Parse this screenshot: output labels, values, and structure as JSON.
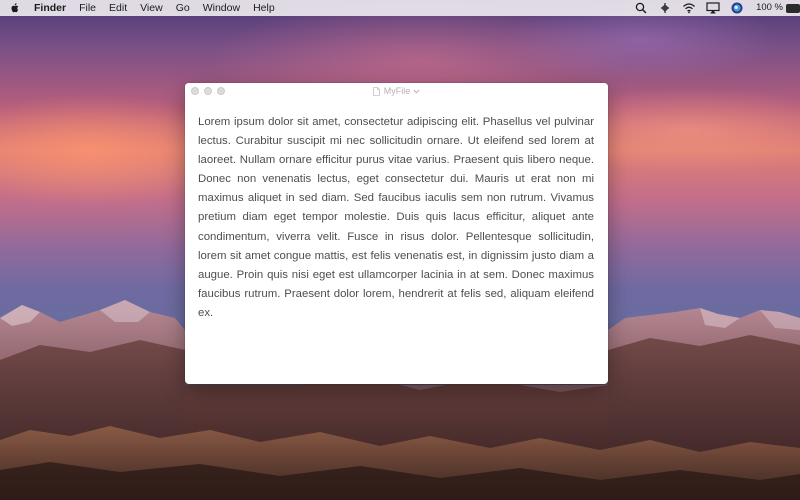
{
  "menubar": {
    "app_name": "Finder",
    "menus": [
      "File",
      "Edit",
      "View",
      "Go",
      "Window",
      "Help"
    ],
    "battery_percent": "100 %"
  },
  "icons": {
    "apple": "apple-logo-icon",
    "search": "search-icon",
    "status2": "status-icon",
    "wifi": "wifi-icon",
    "airplay": "airplay-icon",
    "siri": "siri-icon",
    "battery": "battery-icon"
  },
  "window": {
    "title": "MyFile",
    "body_text": "Lorem ipsum dolor sit amet, consectetur adipiscing elit. Phasellus vel pulvinar lectus. Curabitur suscipit mi nec sollicitudin ornare. Ut eleifend sed lorem at laoreet. Nullam ornare efficitur purus vitae varius. Praesent quis libero neque. Donec non venenatis lectus, eget consectetur dui. Mauris ut erat non mi maximus aliquet in sed diam. Sed faucibus iaculis sem non rutrum. Vivamus pretium diam eget tempor molestie. Duis quis lacus efficitur, aliquet ante condimentum, viverra velit. Fusce in risus dolor. Pellentesque sollicitudin, lorem sit amet congue mattis, est felis venenatis est, in dignissim justo diam a augue. Proin quis nisi eget est ullamcorper lacinia in at sem. Donec maximus faucibus rutrum. Praesent dolor lorem, hendrerit at felis sed, aliquam eleifend ex."
  },
  "colors": {
    "menubar_bg": "#ece8ee",
    "window_bg": "#ffffff",
    "text": "#4e4e4e",
    "title_text": "#b3b3b3"
  }
}
